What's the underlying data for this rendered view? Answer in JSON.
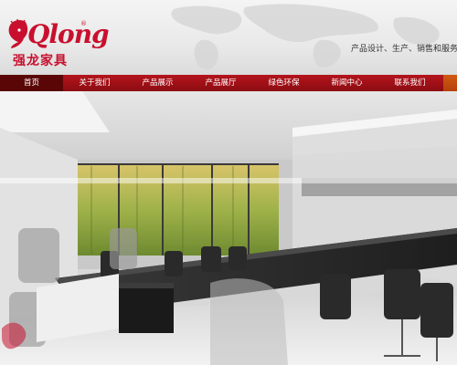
{
  "brand": {
    "logo_text": "Qlong",
    "logo_reg": "®",
    "logo_cn": "强龙家具"
  },
  "header": {
    "slogan": "产品设计、生产、销售和服务于一"
  },
  "nav": {
    "active_index": 0,
    "items": [
      {
        "label": "首页"
      },
      {
        "label": "关于我们"
      },
      {
        "label": "产品展示"
      },
      {
        "label": "产品展厅"
      },
      {
        "label": "绿色环保"
      },
      {
        "label": "新闻中心"
      },
      {
        "label": "联系我们"
      }
    ]
  },
  "colors": {
    "brand_red": "#c8102e",
    "nav_red": "#a01016",
    "nav_active": "#5a0606",
    "nav_accent_orange": "#c44e0e"
  },
  "banner": {
    "image_subject": "office-conference-room-photo"
  }
}
